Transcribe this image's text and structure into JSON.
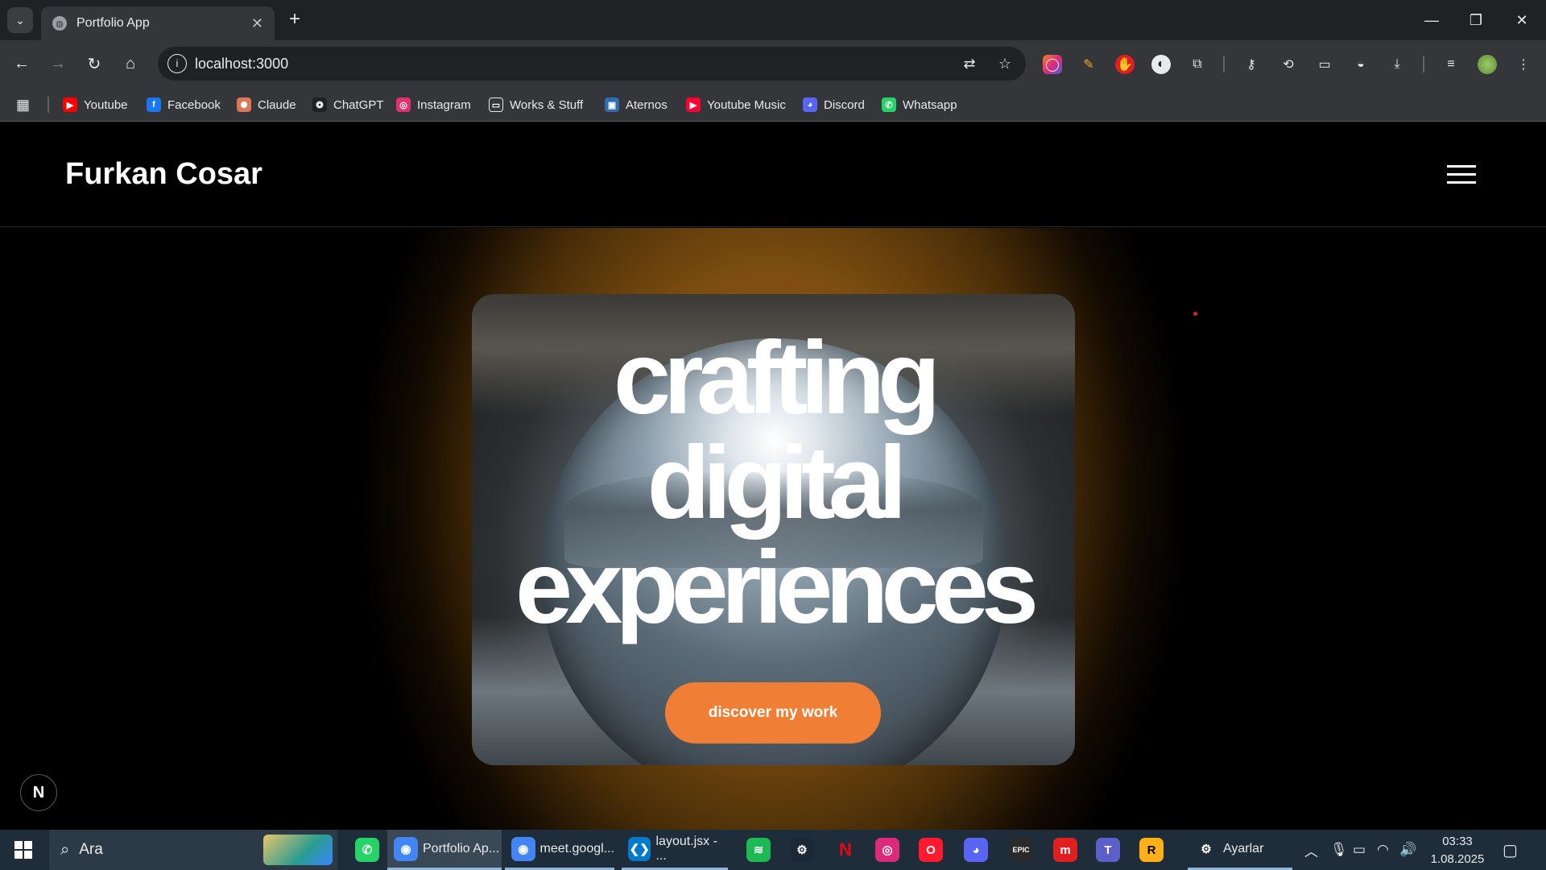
{
  "browser": {
    "tab_title": "Portfolio App",
    "url": "localhost:3000",
    "bookmarks": [
      {
        "label": "Youtube",
        "icon": "youtube-icon",
        "color": "#ff0000"
      },
      {
        "label": "Facebook",
        "icon": "facebook-icon",
        "color": "#1877f2"
      },
      {
        "label": "Claude",
        "icon": "claude-icon",
        "color": "#d97757"
      },
      {
        "label": "ChatGPT",
        "icon": "chatgpt-icon",
        "color": "#202124"
      },
      {
        "label": "Instagram",
        "icon": "instagram-icon",
        "color": "#e1306c"
      },
      {
        "label": "Works & Stuff",
        "icon": "folder-icon",
        "color": "#35363a"
      },
      {
        "label": "Aternos",
        "icon": "aternos-icon",
        "color": "#2f6db3"
      },
      {
        "label": "Youtube Music",
        "icon": "youtube-music-icon",
        "color": "#ff0033"
      },
      {
        "label": "Discord",
        "icon": "discord-icon",
        "color": "#5865f2"
      },
      {
        "label": "Whatsapp",
        "icon": "whatsapp-icon",
        "color": "#25d366"
      }
    ]
  },
  "site": {
    "brand": "Furkan Cosar",
    "headline": [
      "crafting",
      "digital",
      "experiences"
    ],
    "cta_label": "discover my work",
    "accent_color": "#f07f35",
    "next_badge": "N"
  },
  "taskbar": {
    "search_label": "Ara",
    "apps": [
      {
        "label": "",
        "icon": "whatsapp-icon"
      },
      {
        "label": "Portfolio Ap...",
        "icon": "chrome-icon"
      },
      {
        "label": "meet.googl...",
        "icon": "chrome-icon"
      },
      {
        "label": "layout.jsx - ...",
        "icon": "vscode-icon"
      },
      {
        "label": "",
        "icon": "spotify-icon"
      },
      {
        "label": "",
        "icon": "steam-icon"
      },
      {
        "label": "N",
        "icon": "netflix-icon"
      },
      {
        "label": "",
        "icon": "instagram-icon"
      },
      {
        "label": "",
        "icon": "opera-icon"
      },
      {
        "label": "",
        "icon": "discord-icon"
      },
      {
        "label": "EPIC",
        "icon": "epic-games-icon"
      },
      {
        "label": "",
        "icon": "app-red-icon"
      },
      {
        "label": "",
        "icon": "teams-icon"
      },
      {
        "label": "R",
        "icon": "rockstar-icon"
      },
      {
        "label": "Ayarlar",
        "icon": "settings-icon"
      }
    ],
    "time": "03:33",
    "date": "1.08.2025"
  }
}
